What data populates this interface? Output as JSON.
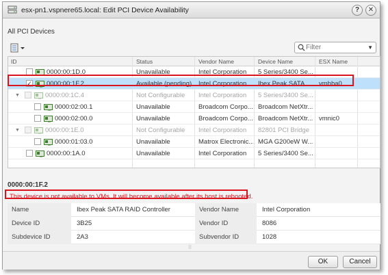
{
  "dialog": {
    "title": "esx-pn1.vspnere65.local: Edit PCI Device Availability",
    "help_glyph": "?",
    "close_glyph": "✕"
  },
  "section_title": "All PCI Devices",
  "filter": {
    "placeholder": "Filter"
  },
  "columns": [
    "ID",
    "Status",
    "Vendor Name",
    "Device Name",
    "ESX Name"
  ],
  "rows": [
    {
      "id": "0000:00:1D.0",
      "status": "Unavailable",
      "vendor": "Intel Corporation",
      "device": "5 Series/3400 Se...",
      "esx": "",
      "checked": false,
      "selected": false,
      "dim": false,
      "expander": ""
    },
    {
      "id": "0000:00:1F.2",
      "status": "Available (pending)",
      "vendor": "Intel Corporation",
      "device": "Ibex Peak SATA ...",
      "esx": "vmhba0",
      "checked": true,
      "selected": true,
      "dim": false,
      "expander": ""
    },
    {
      "id": "0000:00:1C.4",
      "status": "Not Configurable",
      "vendor": "Intel Corporation",
      "device": "5 Series/3400 Se...",
      "esx": "",
      "checked": false,
      "selected": false,
      "dim": true,
      "expander": "▼"
    },
    {
      "id": "0000:02:00.1",
      "status": "Unavailable",
      "vendor": "Broadcom Corpo...",
      "device": "Broadcom NetXtr...",
      "esx": "",
      "checked": false,
      "selected": false,
      "dim": false,
      "expander": ""
    },
    {
      "id": "0000:02:00.0",
      "status": "Unavailable",
      "vendor": "Broadcom Corpo...",
      "device": "Broadcom NetXtr...",
      "esx": "vmnic0",
      "checked": false,
      "selected": false,
      "dim": false,
      "expander": ""
    },
    {
      "id": "0000:00:1E.0",
      "status": "Not Configurable",
      "vendor": "Intel Corporation",
      "device": "82801 PCI Bridge",
      "esx": "",
      "checked": false,
      "selected": false,
      "dim": true,
      "expander": "▼"
    },
    {
      "id": "0000:01:03.0",
      "status": "Unavailable",
      "vendor": "Matrox Electronic...",
      "device": "MGA G200eW W...",
      "esx": "",
      "checked": false,
      "selected": false,
      "dim": false,
      "expander": ""
    },
    {
      "id": "0000:00:1A.0",
      "status": "Unavailable",
      "vendor": "Intel Corporation",
      "device": "5 Series/3400 Se...",
      "esx": "",
      "checked": false,
      "selected": false,
      "dim": false,
      "expander": ""
    }
  ],
  "detail": {
    "title": "0000:00:1F.2",
    "message": "This device is not available to VMs. It will become available after its host is rebooted.",
    "props": [
      {
        "l1": "Name",
        "v1": "Ibex Peak SATA RAID Controller",
        "l2": "Vendor Name",
        "v2": "Intel Corporation"
      },
      {
        "l1": "Device ID",
        "v1": "3B25",
        "l2": "Vendor ID",
        "v2": "8086"
      },
      {
        "l1": "Subdevice ID",
        "v1": "2A3",
        "l2": "Subvendor ID",
        "v2": "1028"
      }
    ]
  },
  "buttons": {
    "ok": "OK",
    "cancel": "Cancel"
  },
  "colors": {
    "selection": "#bfe0fb",
    "highlight_border": "#d9141f",
    "message_text": "#d9141f"
  }
}
